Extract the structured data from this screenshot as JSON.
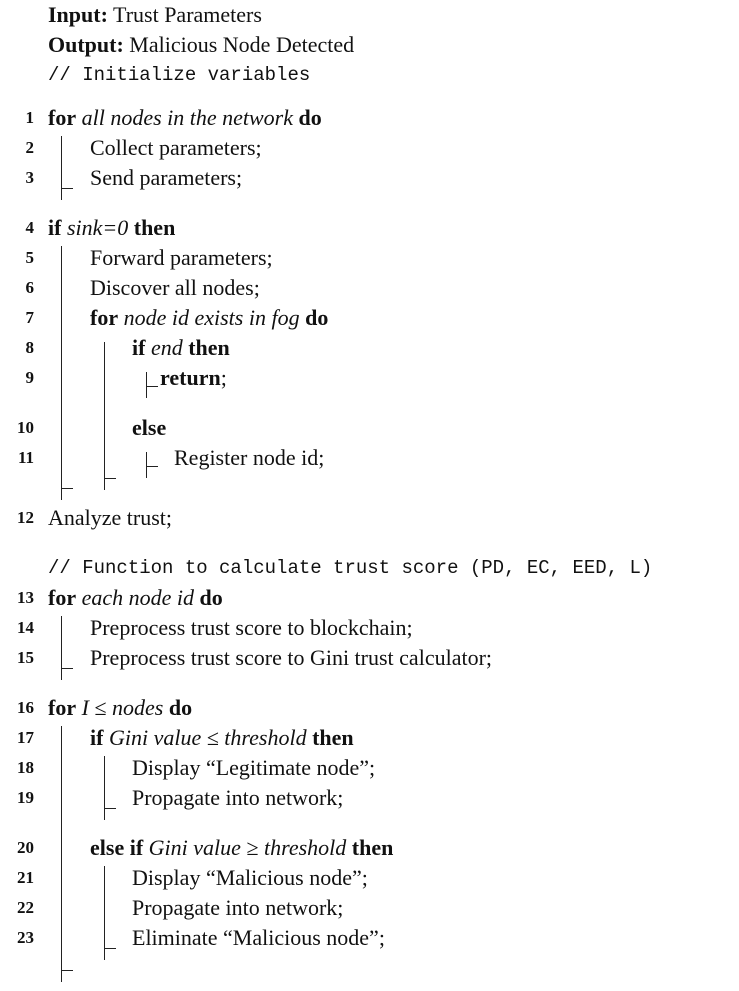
{
  "header": {
    "input_label": "Input:",
    "input_value": "Trust Parameters",
    "output_label": "Output:",
    "output_value": "Malicious Node Detected",
    "comment_init": "// Initialize variables"
  },
  "lines": {
    "l1": {
      "num": "1",
      "kw1": "for",
      "cond": "all nodes in the network",
      "kw2": "do"
    },
    "l2": {
      "num": "2",
      "text": "Collect parameters;"
    },
    "l3": {
      "num": "3",
      "text": "Send parameters;"
    },
    "l4": {
      "num": "4",
      "kw1": "if",
      "cond": "sink=0",
      "kw2": "then"
    },
    "l5": {
      "num": "5",
      "text": "Forward parameters;"
    },
    "l6": {
      "num": "6",
      "text": "Discover all nodes;"
    },
    "l7": {
      "num": "7",
      "kw1": "for",
      "cond": "node id exists in fog",
      "kw2": "do"
    },
    "l8": {
      "num": "8",
      "kw1": "if",
      "cond": "end",
      "kw2": "then"
    },
    "l9": {
      "num": "9",
      "kw": "return",
      "suffix": ";"
    },
    "l10": {
      "num": "10",
      "kw": "else"
    },
    "l11": {
      "num": "11",
      "text": "Register node id;"
    },
    "l12": {
      "num": "12",
      "text": "Analyze trust;"
    },
    "comment_fn": "// Function to calculate trust score (PD, EC, EED, L)",
    "l13": {
      "num": "13",
      "kw1": "for",
      "cond": "each node id",
      "kw2": "do"
    },
    "l14": {
      "num": "14",
      "text": "Preprocess trust score to blockchain;"
    },
    "l15": {
      "num": "15",
      "text": "Preprocess trust score to Gini trust calculator;"
    },
    "l16": {
      "num": "16",
      "kw1": "for",
      "cond": "I ≤ nodes",
      "kw2": "do"
    },
    "l17": {
      "num": "17",
      "kw1": "if",
      "cond": "Gini value ≤ threshold",
      "kw2": "then"
    },
    "l18": {
      "num": "18",
      "text": "Display “Legitimate node”;"
    },
    "l19": {
      "num": "19",
      "text": "Propagate into network;"
    },
    "l20": {
      "num": "20",
      "kw1": "else if",
      "cond": "Gini value ≥ threshold",
      "kw2": "then"
    },
    "l21": {
      "num": "21",
      "text": "Display “Malicious node”;"
    },
    "l22": {
      "num": "22",
      "text": "Propagate into network;"
    },
    "l23": {
      "num": "23",
      "text": "Eliminate “Malicious node”;"
    }
  }
}
